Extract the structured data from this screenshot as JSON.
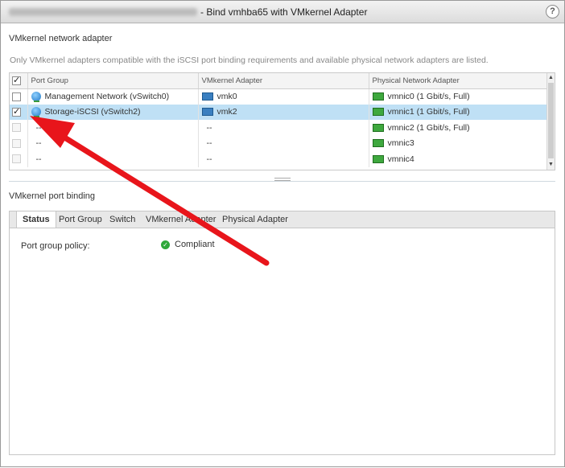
{
  "dialog": {
    "title": "- Bind vmhba65 with VMkernel Adapter",
    "help_label": "?"
  },
  "adapter_section": {
    "title": "VMkernel network adapter",
    "description": "Only VMkernel adapters compatible with the iSCSI port binding requirements and available physical network adapters are listed."
  },
  "grid": {
    "columns": [
      "Port Group",
      "VMkernel Adapter",
      "Physical Network Adapter"
    ],
    "rows": [
      {
        "checked": false,
        "disabled": false,
        "selected": false,
        "port_group": "Management Network (vSwitch0)",
        "vmk": "vmk0",
        "nic": "vmnic0 (1 Gbit/s, Full)"
      },
      {
        "checked": true,
        "disabled": false,
        "selected": true,
        "port_group": "Storage-iSCSI (vSwitch2)",
        "vmk": "vmk2",
        "nic": "vmnic1 (1 Gbit/s, Full)"
      },
      {
        "checked": false,
        "disabled": true,
        "selected": false,
        "port_group": "--",
        "vmk": "--",
        "nic": "vmnic2 (1 Gbit/s, Full)"
      },
      {
        "checked": false,
        "disabled": true,
        "selected": false,
        "port_group": "--",
        "vmk": "--",
        "nic": "vmnic3"
      },
      {
        "checked": false,
        "disabled": true,
        "selected": false,
        "port_group": "--",
        "vmk": "--",
        "nic": "vmnic4"
      }
    ]
  },
  "binding_section": {
    "title": "VMkernel port binding",
    "tabs": [
      "Status",
      "Port Group",
      "Switch",
      "VMkernel Adapter",
      "Physical Adapter"
    ],
    "active_tab": "Status",
    "policy_label": "Port group policy:",
    "policy_value": "Compliant"
  },
  "colors": {
    "selection": "#bfe0f5",
    "annotation_arrow": "#e8151b",
    "ok": "#2fa83a"
  }
}
